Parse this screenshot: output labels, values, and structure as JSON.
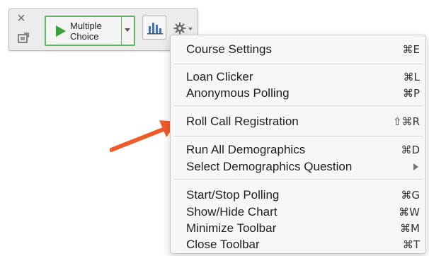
{
  "toolbar": {
    "close_icon": "close-icon",
    "screen_icon": "screen-share-icon",
    "start_button": {
      "label": "Multiple Choice",
      "line1": "Multiple",
      "line2": "Choice",
      "icon": "play-icon",
      "accent": "#36a336"
    },
    "chart_icon": "bar-chart-icon",
    "settings_icon": "gear-icon"
  },
  "menu": {
    "sections": [
      [
        {
          "label": "Course Settings",
          "shortcut": "⌘E"
        }
      ],
      [
        {
          "label": "Loan Clicker",
          "shortcut": "⌘L"
        },
        {
          "label": "Anonymous Polling",
          "shortcut": "⌘P"
        }
      ],
      [
        {
          "label": "Roll Call Registration",
          "shortcut": "⇧⌘R"
        }
      ],
      [
        {
          "label": "Run All Demographics",
          "shortcut": "⌘D"
        },
        {
          "label": "Select Demographics Question",
          "shortcut": "",
          "submenu": true
        }
      ],
      [
        {
          "label": "Start/Stop Polling",
          "shortcut": "⌘G"
        },
        {
          "label": "Show/Hide Chart",
          "shortcut": "⌘W"
        },
        {
          "label": "Minimize Toolbar",
          "shortcut": "⌘M"
        },
        {
          "label": "Close Toolbar",
          "shortcut": "⌘T"
        }
      ]
    ]
  },
  "annotation": {
    "type": "arrow",
    "color": "#f05a28"
  }
}
